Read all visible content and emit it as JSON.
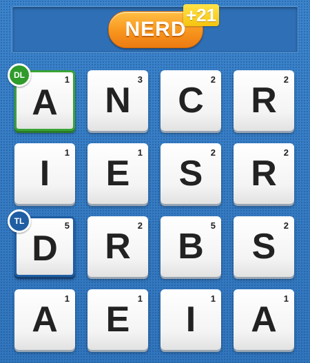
{
  "header": {
    "word": "NERD",
    "score_badge": "+21"
  },
  "colors": {
    "background": "#3a7fc6",
    "word_pill": "#f8951d",
    "score_badge": "#f5c40f",
    "double_letter": "#2f9b2b",
    "triple_letter": "#1f5ea3"
  },
  "board": {
    "rows": [
      [
        {
          "letter": "A",
          "points": "1",
          "bonus": "DL"
        },
        {
          "letter": "N",
          "points": "3",
          "bonus": ""
        },
        {
          "letter": "C",
          "points": "2",
          "bonus": ""
        },
        {
          "letter": "R",
          "points": "2",
          "bonus": ""
        }
      ],
      [
        {
          "letter": "I",
          "points": "1",
          "bonus": ""
        },
        {
          "letter": "E",
          "points": "1",
          "bonus": ""
        },
        {
          "letter": "S",
          "points": "2",
          "bonus": ""
        },
        {
          "letter": "R",
          "points": "2",
          "bonus": ""
        }
      ],
      [
        {
          "letter": "D",
          "points": "5",
          "bonus": "TL"
        },
        {
          "letter": "R",
          "points": "2",
          "bonus": ""
        },
        {
          "letter": "B",
          "points": "5",
          "bonus": ""
        },
        {
          "letter": "S",
          "points": "2",
          "bonus": ""
        }
      ],
      [
        {
          "letter": "A",
          "points": "1",
          "bonus": ""
        },
        {
          "letter": "E",
          "points": "1",
          "bonus": ""
        },
        {
          "letter": "I",
          "points": "1",
          "bonus": ""
        },
        {
          "letter": "A",
          "points": "1",
          "bonus": ""
        }
      ]
    ]
  }
}
